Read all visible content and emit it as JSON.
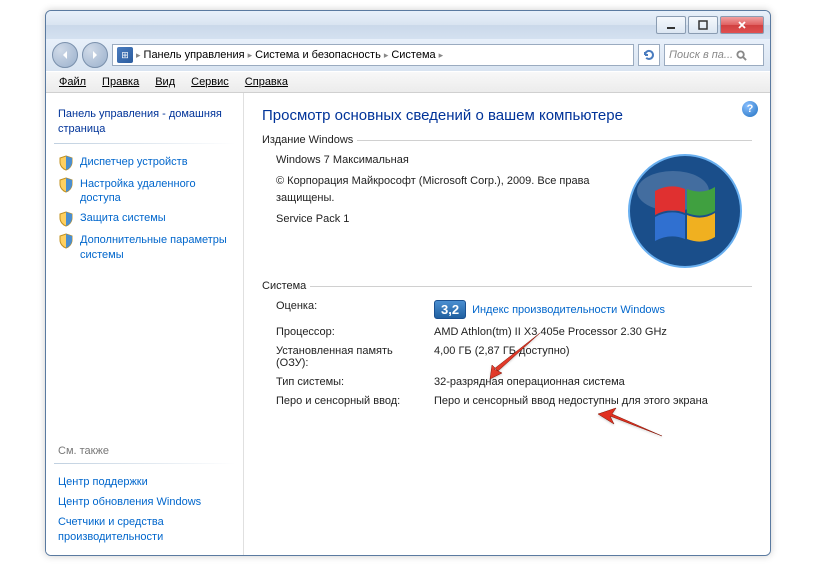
{
  "breadcrumb": {
    "items": [
      "Панель управления",
      "Система и безопасность",
      "Система"
    ]
  },
  "search": {
    "placeholder": "Поиск в па..."
  },
  "menubar": [
    "Файл",
    "Правка",
    "Вид",
    "Сервис",
    "Справка"
  ],
  "sidebar": {
    "home": "Панель управления - домашняя страница",
    "links": [
      "Диспетчер устройств",
      "Настройка удаленного доступа",
      "Защита системы",
      "Дополнительные параметры системы"
    ],
    "see_also_title": "См. также",
    "see_also": [
      "Центр поддержки",
      "Центр обновления Windows",
      "Счетчики и средства производительности"
    ]
  },
  "main": {
    "title": "Просмотр основных сведений о вашем компьютере",
    "edition": {
      "legend": "Издание Windows",
      "name": "Windows 7 Максимальная",
      "copyright": "© Корпорация Майкрософт (Microsoft Corp.), 2009. Все права защищены.",
      "sp": "Service Pack 1"
    },
    "system": {
      "legend": "Система",
      "rating_label": "Оценка:",
      "rating_value": "3,2",
      "rating_link": "Индекс производительности Windows",
      "cpu_label": "Процессор:",
      "cpu_value": "AMD Athlon(tm) II X3 405e Processor   2.30 GHz",
      "ram_label": "Установленная память (ОЗУ):",
      "ram_value": "4,00 ГБ (2,87 ГБ доступно)",
      "type_label": "Тип системы:",
      "type_value": "32-разрядная операционная система",
      "pen_label": "Перо и сенсорный ввод:",
      "pen_value": "Перо и сенсорный ввод недоступны для этого экрана"
    }
  }
}
